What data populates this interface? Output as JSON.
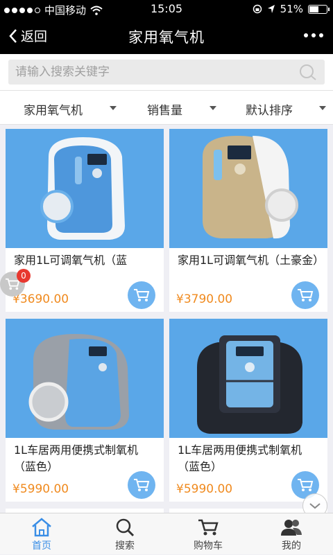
{
  "status_bar": {
    "carrier": "中国移动",
    "time": "15:05",
    "battery": "51%",
    "battery_level": 0.51
  },
  "nav": {
    "back_label": "返回",
    "title": "家用氧气机"
  },
  "search": {
    "placeholder": "请输入搜索关键字"
  },
  "filters": [
    {
      "label": "家用氧气机"
    },
    {
      "label": "销售量"
    },
    {
      "label": "默认排序"
    }
  ],
  "products": [
    {
      "name": "家用1L可调氧气机（蓝",
      "price": "¥3690.00",
      "color": "#4fa3e0"
    },
    {
      "name": "家用1L可调氧气机（土豪金）",
      "price": "¥3790.00",
      "color": "#c9b48a"
    },
    {
      "name": "1L车居两用便携式制氧机（蓝色）",
      "price": "¥5990.00",
      "color": "#4fa3e0"
    },
    {
      "name": "1L车居两用便携式制氧机（蓝色）",
      "price": "¥5990.00",
      "color": "#2a2f3a"
    }
  ],
  "cart_badge": "0",
  "tabbar": [
    {
      "label": "首页",
      "icon": "home-icon"
    },
    {
      "label": "搜索",
      "icon": "search-icon"
    },
    {
      "label": "购物车",
      "icon": "cart-icon"
    },
    {
      "label": "我的",
      "icon": "user-icon"
    }
  ],
  "colors": {
    "accent": "#3a8ee6",
    "price": "#f08a1e",
    "cart_button": "#6fb4f0",
    "image_bg": "#5aa7e8"
  }
}
